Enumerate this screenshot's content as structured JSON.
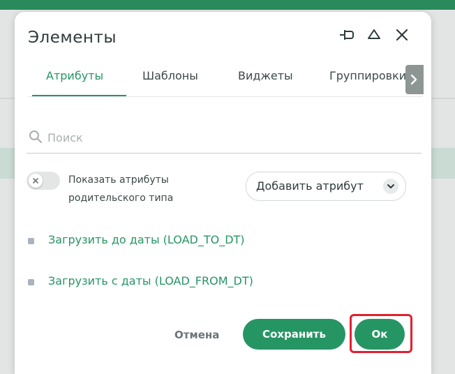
{
  "dialog": {
    "title": "Элементы",
    "header_icons": [
      "pin-icon",
      "collapse-icon",
      "close-icon"
    ]
  },
  "tabs": [
    {
      "label": "Атрибуты",
      "active": true
    },
    {
      "label": "Шаблоны",
      "active": false
    },
    {
      "label": "Виджеты",
      "active": false
    },
    {
      "label": "Группировки",
      "active": false
    }
  ],
  "search": {
    "placeholder": "Поиск",
    "value": ""
  },
  "toggle": {
    "label": "Показать атрибуты родительского типа",
    "checked": false
  },
  "add_attribute": {
    "label": "Добавить атрибут"
  },
  "attributes": [
    {
      "label": "Загрузить до даты (LOAD_TO_DT)"
    },
    {
      "label": "Загрузить с даты (LOAD_FROM_DT)"
    }
  ],
  "footer": {
    "cancel_label": "Отмена",
    "save_label": "Сохранить",
    "ok_label": "Ок"
  },
  "colors": {
    "accent": "#269564",
    "topbar": "#2b8a5c",
    "highlight": "#e02030"
  }
}
